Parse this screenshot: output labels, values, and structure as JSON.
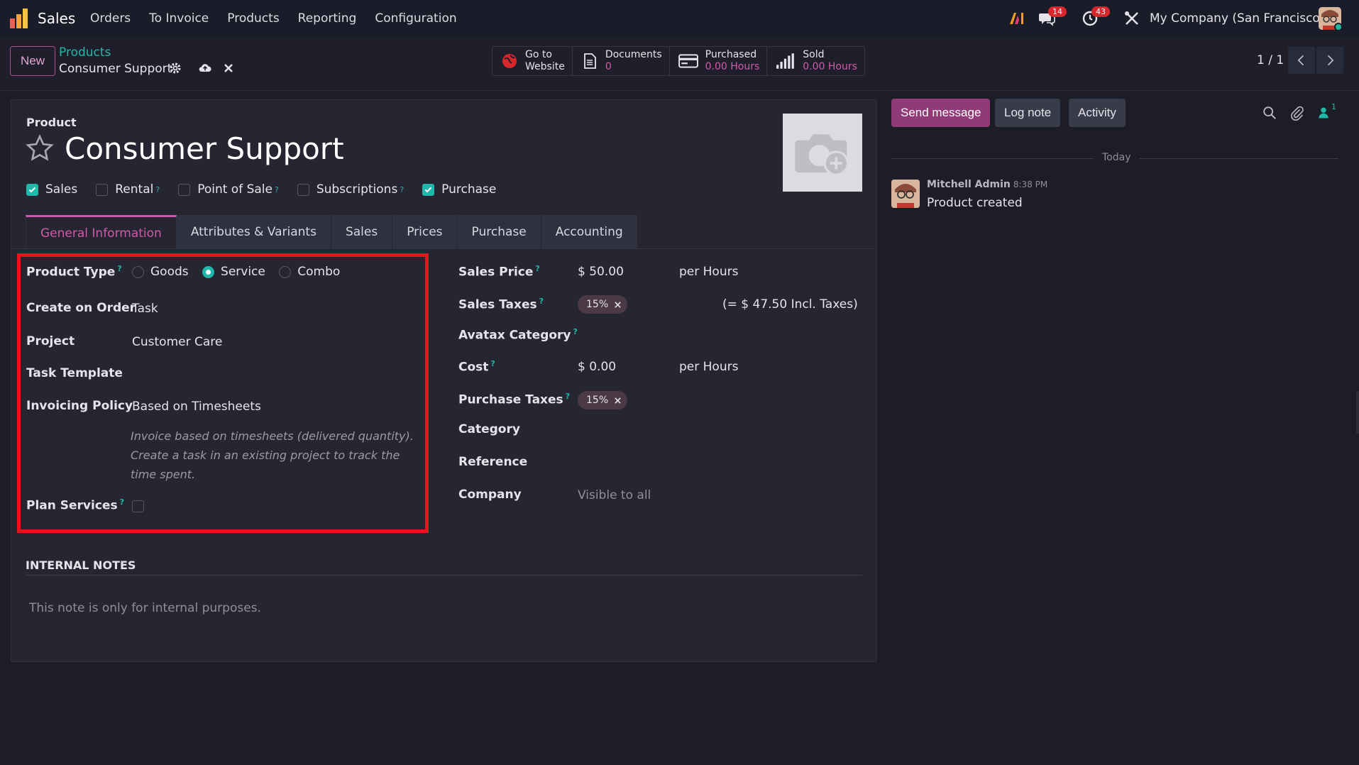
{
  "navbar": {
    "app_name": "Sales",
    "menu": [
      "Orders",
      "To Invoice",
      "Products",
      "Reporting",
      "Configuration"
    ],
    "messages_count": "14",
    "activities_count": "43",
    "company": "My Company (San Francisco)"
  },
  "controlbar": {
    "new_label": "New",
    "breadcrumb": "Products",
    "record_name": "Consumer Support",
    "smart_buttons": [
      {
        "line1": "Go to",
        "line2": "Website"
      },
      {
        "line1": "Documents",
        "line2": "0"
      },
      {
        "line1": "Purchased",
        "line2": "0.00 Hours"
      },
      {
        "line1": "Sold",
        "line2": "0.00 Hours"
      }
    ],
    "pager": "1 / 1"
  },
  "form": {
    "type_label": "Product",
    "name": "Consumer Support",
    "checkboxes": [
      {
        "label": "Sales",
        "checked": true,
        "help": false
      },
      {
        "label": "Rental",
        "checked": false,
        "help": true
      },
      {
        "label": "Point of Sale",
        "checked": false,
        "help": true
      },
      {
        "label": "Subscriptions",
        "checked": false,
        "help": true
      },
      {
        "label": "Purchase",
        "checked": true,
        "help": false
      }
    ],
    "tabs": [
      "General Information",
      "Attributes & Variants",
      "Sales",
      "Prices",
      "Purchase",
      "Accounting"
    ],
    "left": {
      "product_type_label": "Product Type",
      "product_type_options": [
        "Goods",
        "Service",
        "Combo"
      ],
      "create_on_order_label": "Create on Order",
      "create_on_order_value": "Task",
      "project_label": "Project",
      "project_value": "Customer Care",
      "task_template_label": "Task Template",
      "invoicing_policy_label": "Invoicing Policy",
      "invoicing_policy_value": "Based on Timesheets",
      "invoicing_help": "Invoice based on timesheets (delivered quantity). Create a task in an existing project to track the time spent.",
      "plan_services_label": "Plan Services"
    },
    "right": {
      "sales_price_label": "Sales Price",
      "sales_price_value": "$ 50.00",
      "sales_price_unit": "per Hours",
      "sales_taxes_label": "Sales Taxes",
      "sales_taxes_tag": "15%",
      "sales_taxes_incl": "(= $ 47.50 Incl. Taxes)",
      "avatax_label": "Avatax Category",
      "cost_label": "Cost",
      "cost_value": "$ 0.00",
      "cost_unit": "per Hours",
      "purchase_taxes_label": "Purchase Taxes",
      "purchase_taxes_tag": "15%",
      "category_label": "Category",
      "reference_label": "Reference",
      "company_label": "Company",
      "company_value": "Visible to all"
    },
    "internal_notes_title": "INTERNAL NOTES",
    "internal_notes_placeholder": "This note is only for internal purposes."
  },
  "chatter": {
    "send_message": "Send message",
    "log_note": "Log note",
    "activity": "Activity",
    "followers_count": "1",
    "today": "Today",
    "message": {
      "author": "Mitchell Admin",
      "time": "8:38 PM",
      "body": "Product created"
    }
  }
}
